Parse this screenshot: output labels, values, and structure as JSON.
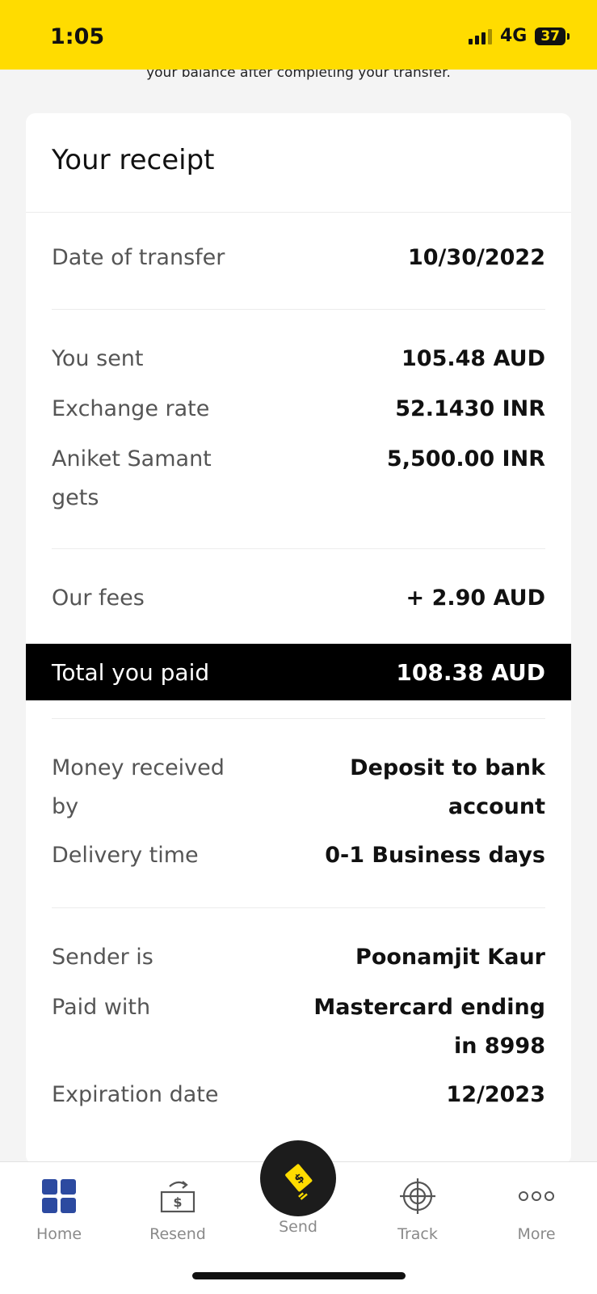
{
  "status_bar": {
    "time": "1:05",
    "network": "4G",
    "battery": "37"
  },
  "top_note": "your balance after completing your transfer.",
  "receipt": {
    "title": "Your receipt",
    "date_label": "Date of transfer",
    "date_value": "10/30/2022",
    "sent_label": "You sent",
    "sent_value": "105.48 AUD",
    "rate_label": "Exchange rate",
    "rate_value": "52.1430 INR",
    "gets_label": "Aniket Samant gets",
    "gets_value": "5,500.00 INR",
    "fees_label": "Our fees",
    "fees_value": "+ 2.90 AUD",
    "total_label": "Total you paid",
    "total_value": "108.38 AUD",
    "received_label": "Money received by",
    "received_value": "Deposit to bank account",
    "delivery_label": "Delivery time",
    "delivery_value": "0-1 Business days",
    "sender_label": "Sender is",
    "sender_value": "Poonamjit Kaur",
    "paid_label": "Paid with",
    "paid_value": "Mastercard ending in 8998",
    "expiry_label": "Expiration date",
    "expiry_value": "12/2023"
  },
  "tabs": {
    "home": "Home",
    "resend": "Resend",
    "send": "Send",
    "track": "Track",
    "more": "More"
  },
  "colors": {
    "brand_yellow": "#ffdc00",
    "home_blue": "#2c4aa0"
  }
}
